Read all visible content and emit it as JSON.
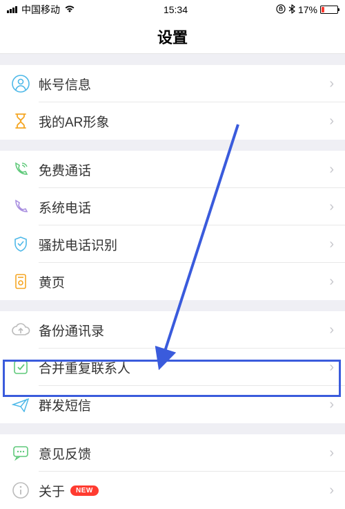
{
  "status": {
    "carrier": "中国移动",
    "time": "15:34",
    "battery": "17%"
  },
  "header": {
    "title": "设置"
  },
  "groups": {
    "g1": {
      "account": "帐号信息",
      "ar": "我的AR形象"
    },
    "g2": {
      "free_call": "免费通话",
      "system_call": "系统电话",
      "spam": "骚扰电话识别",
      "yellow_pages": "黄页"
    },
    "g3": {
      "backup": "备份通讯录",
      "merge": "合并重复联系人",
      "bulk_sms": "群发短信"
    },
    "g4": {
      "feedback": "意见反馈",
      "about": "关于",
      "new_badge": "NEW"
    }
  },
  "icons": {
    "user": "person-icon",
    "ar": "hourglass-icon",
    "free_call": "phone-wifi-icon",
    "system_call": "phone-icon",
    "spam": "shield-icon",
    "yellow_pages": "page-icon",
    "backup": "cloud-upload-icon",
    "merge": "checkbox-icon",
    "bulk_sms": "send-icon",
    "feedback": "chat-icon",
    "about": "info-icon"
  }
}
